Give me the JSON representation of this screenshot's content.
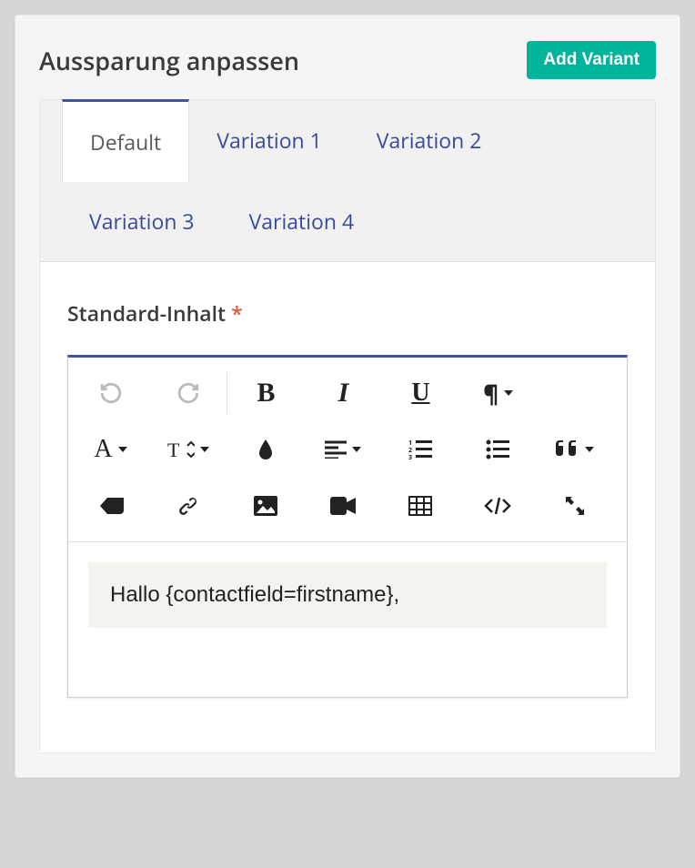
{
  "header": {
    "title": "Aussparung anpassen",
    "add_variant": "Add Variant"
  },
  "tabs": [
    {
      "label": "Default",
      "active": true
    },
    {
      "label": "Variation 1",
      "active": false
    },
    {
      "label": "Variation 2",
      "active": false
    },
    {
      "label": "Variation 3",
      "active": false
    },
    {
      "label": "Variation 4",
      "active": false
    }
  ],
  "content": {
    "label": "Standard-Inhalt",
    "required_marker": "*",
    "body": "Hallo {contactfield=firstname},"
  },
  "toolbar": {
    "undo": "undo",
    "redo": "redo",
    "bold": "bold",
    "italic": "italic",
    "underline": "underline",
    "paragraph": "paragraph",
    "font_family": "font-family",
    "font_size": "font-size",
    "color": "color",
    "align": "align",
    "ol": "ordered-list",
    "ul": "unordered-list",
    "quote": "quote",
    "clear": "clear-formatting",
    "link": "link",
    "image": "image",
    "video": "video",
    "table": "table",
    "html": "html",
    "fullscreen": "fullscreen"
  }
}
